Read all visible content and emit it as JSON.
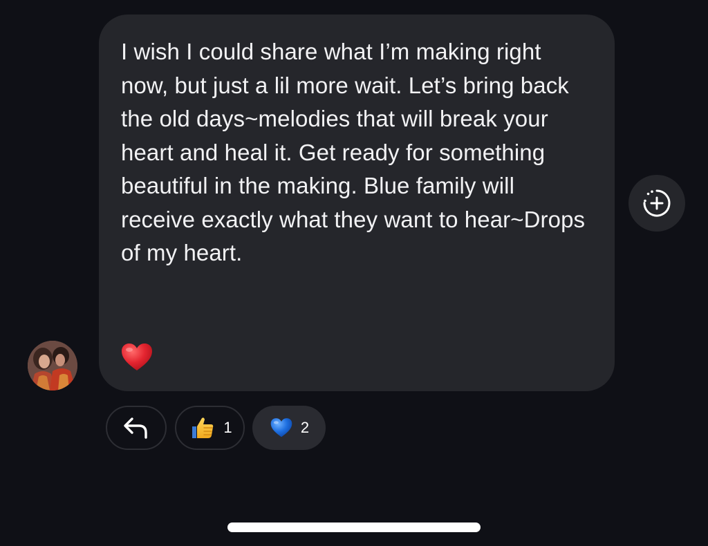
{
  "message": {
    "text": "I wish I could share what I’m making right now, but just a lil more wait. Let’s bring back the old days~melodies that will break your heart and heal it. Get ready for something beautiful in the making. Blue family will receive exactly what they want to hear~Drops of my heart.",
    "emoji": "red-heart-icon"
  },
  "sender": {
    "avatar": "couple-photo-avatar"
  },
  "add_reaction": {
    "icon": "add-reaction-icon"
  },
  "reactions": [
    {
      "icon": "reply-arrow-icon",
      "count": ""
    },
    {
      "icon": "thumbs-up-icon",
      "count": "1"
    },
    {
      "icon": "blue-heart-icon",
      "count": "2"
    }
  ],
  "colors": {
    "background": "#0f1016",
    "bubble": "#25262b",
    "text": "#f2f2f4",
    "red_heart": "#e0242e",
    "blue_heart": "#1e6fe0",
    "thumbs_up": "#f5c33b"
  }
}
